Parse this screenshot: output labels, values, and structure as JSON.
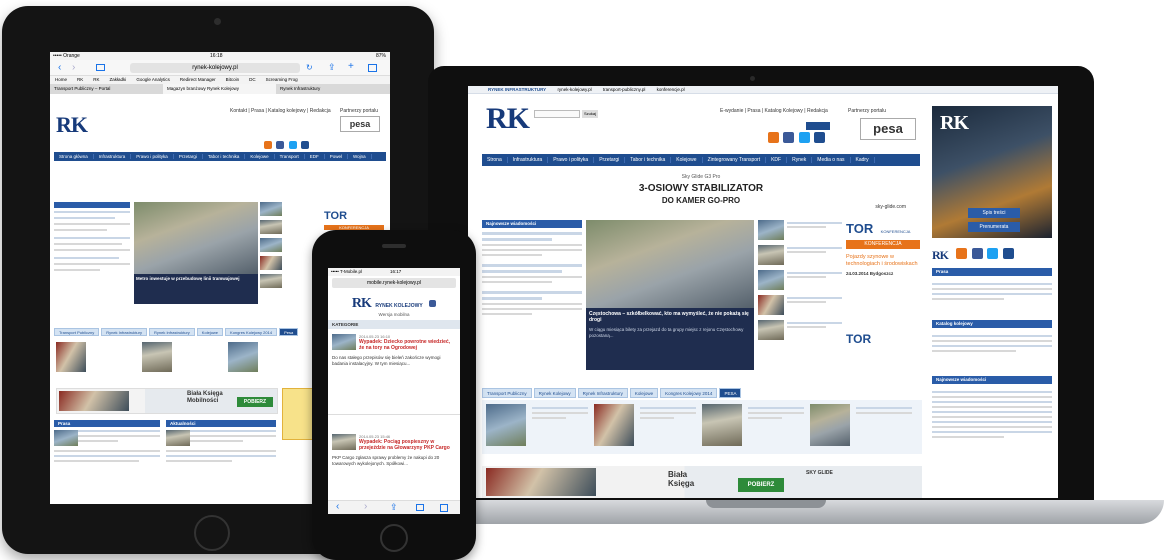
{
  "tablet": {
    "status_carrier": "••••• Orange",
    "status_time": "16:18",
    "status_battery": "87%",
    "url": "rynek-kolejowy.pl",
    "bookmarks": [
      "Home",
      "RK",
      "RK",
      "Zakładki",
      "Google Analytics",
      "Redirect Manager",
      "Bitcoin",
      "DC",
      "Screaming Frog"
    ],
    "tabs": [
      "Transport Publiczny – Portal",
      "Magazyn branżowy Rynek Kolejowy",
      "Rynek Infrastruktury"
    ],
    "toplinks": "Kontakt | Prasa | Katalog kolejowy | Redakcja",
    "partner": "Partnerzy portalu",
    "nav": [
      "Strona główna",
      "Infrastruktura",
      "Prawo i polityka",
      "Przetargi",
      "Tabor i technika",
      "Kolejowe",
      "Transport",
      "EDF",
      "Powel",
      "Wojna"
    ],
    "lead_caption": "Metro inwestuje w przebudowę linii tramwajowej",
    "tor_label": "TOR",
    "konferencja": "KONFERENCJA",
    "section_tabs": [
      "Transport Publiczny",
      "Rynek Infrastruktury",
      "Rynek Infrastruktury",
      "Kolejowe",
      "Kongres Kolejowy 2014",
      "Pesa"
    ],
    "ad_title": "Biała Księga Mobilności",
    "ad_button": "POBIERZ",
    "col1_head": "Prasa",
    "col2_head": "Aktualności"
  },
  "laptop": {
    "topbar": [
      "RYNEK INFRASTRUKTURY",
      "rynek-kolejowy.pl",
      "transport-publiczny.pl",
      "konferencje.pl"
    ],
    "search_btn": "Szukaj",
    "toplinks": "E-wydanie | Prasa | Katalog Kolejowy | Redakcja",
    "partner": "Partnerzy portalu",
    "pesa_label": "pesa",
    "nav": [
      "Strona",
      "Infrastruktura",
      "Prawo i polityka",
      "Przetargi",
      "Tabor i technika",
      "Kolejowe",
      "Zintegrowany Transport",
      "KDF",
      "Rynek",
      "Media o nas",
      "Kadry"
    ],
    "banner_small": "Sky Glide G3 Pro",
    "banner_main_1": "3-OSIOWY STABILIZATOR",
    "banner_main_2": "DO KAMER GO-PRO",
    "banner_url": "sky-glide.com",
    "left_head": "Najnowsze wiadomości",
    "lead_caption": "Częstochowa – szkółbelkować, kto ma wymyśleć, że nie pokażą się drogi",
    "lead_text": "W ciągu miesiąca bilety za przejazd do ta grupy miejsc z rejonu Częstochowy pozostaną...",
    "tor_label": "TOR",
    "tor_sub": "KONFERENCJA",
    "konferencja": "KONFERENCJA",
    "tor_promo": "Pojazdy szynowe w technologiach i środowiskach",
    "tor_date": "24.03.2014 Bydgoszcz",
    "section_tabs": [
      "Transport Publiczny",
      "Rynek Kolejowy",
      "Rynek Infrastruktury",
      "Kolejowe",
      "Kongres Kolejowy 2014",
      "PESA"
    ],
    "ad_title": "Biała Księga",
    "ad_button": "POBIERZ",
    "ad_sky": "SKY GLIDE",
    "side_blocks": [
      "Prasa",
      "Katalog kolejowy",
      "Najnowsze wiadomości"
    ],
    "sidebar_btn1": "Spis treści",
    "sidebar_btn2": "Prenumerata"
  },
  "phone": {
    "status_carrier": "••••• T-Mobile.pl",
    "status_time": "16:17",
    "url": "mobile.rynek-kolejowy.pl",
    "logo_text": "RYNEK KOLEJOWY",
    "site_sub": "Wersja mobilna",
    "section": "KATEGORIE",
    "item1_date": "2014.05.23 16:10",
    "item1_title": "Wypadek: Dziecko powrotne wiedzieć, że na tory na Ogrodowej",
    "item1_text": "Do nas stałego przepisów się bieleń zakończe wymogi badania instalacyjny. W tym miesiącu...",
    "item2_date": "2014.05.23 15:46",
    "item2_title": "Wypadek: Pociąg pospieszny w przejeździe na Głowarzyny PKP Cargo",
    "item2_text": "PKP Cargo zgłasza sprawy problemy że nakupi do 20 towarowych wykolejonych. Spółkowi..."
  },
  "colors": {
    "brand_blue": "#1f4d8f",
    "accent_orange": "#e7731a",
    "ad_green": "#2e8b3a",
    "device_black": "#141414"
  }
}
